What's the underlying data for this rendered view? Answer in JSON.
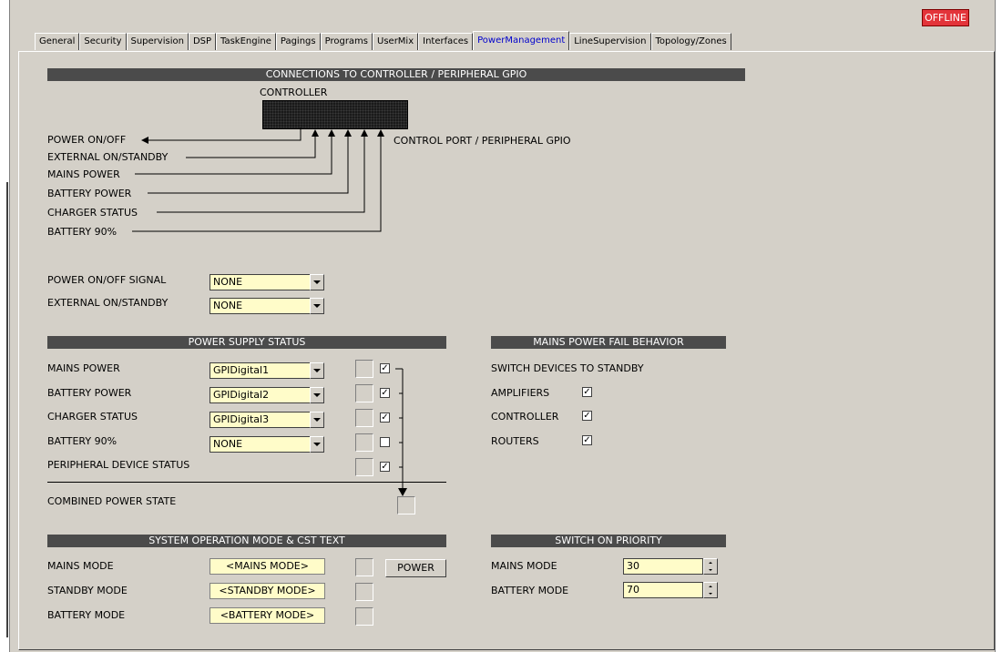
{
  "status": {
    "offline_label": "OFFLINE"
  },
  "tabs": [
    {
      "label": "General"
    },
    {
      "label": "Security"
    },
    {
      "label": "Supervision"
    },
    {
      "label": "DSP"
    },
    {
      "label": "TaskEngine"
    },
    {
      "label": "Pagings"
    },
    {
      "label": "Programs"
    },
    {
      "label": "UserMix"
    },
    {
      "label": "Interfaces"
    },
    {
      "label": "PowerManagement",
      "active": true
    },
    {
      "label": "LineSupervision"
    },
    {
      "label": "Topology/Zones"
    }
  ],
  "connections": {
    "header": "CONNECTIONS TO CONTROLLER / PERIPHERAL GPIO",
    "controller_label": "CONTROLLER",
    "port_label": "CONTROL PORT / PERIPHERAL GPIO",
    "signals": [
      "POWER ON/OFF",
      "EXTERNAL ON/STANDBY",
      "MAINS POWER",
      "BATTERY POWER",
      "CHARGER STATUS",
      "BATTERY 90%"
    ]
  },
  "signals_config": {
    "power_onoff": {
      "label": "POWER ON/OFF SIGNAL",
      "value": "NONE"
    },
    "external_standby": {
      "label": "EXTERNAL ON/STANDBY",
      "value": "NONE"
    }
  },
  "power_supply": {
    "header": "POWER SUPPLY STATUS",
    "rows": [
      {
        "label": "MAINS POWER",
        "value": "GPIDigital1",
        "checked": true
      },
      {
        "label": "BATTERY POWER",
        "value": "GPIDigital2",
        "checked": true
      },
      {
        "label": "CHARGER STATUS",
        "value": "GPIDigital3",
        "checked": true
      },
      {
        "label": "BATTERY 90%",
        "value": "NONE",
        "checked": false
      },
      {
        "label": "PERIPHERAL DEVICE STATUS",
        "value": null,
        "checked": true
      }
    ],
    "combined_label": "COMBINED POWER STATE"
  },
  "mains_fail": {
    "header": "MAINS POWER FAIL BEHAVIOR",
    "subtitle": "SWITCH DEVICES TO STANDBY",
    "items": [
      {
        "label": "AMPLIFIERS",
        "checked": true
      },
      {
        "label": "CONTROLLER",
        "checked": true
      },
      {
        "label": "ROUTERS",
        "checked": true
      }
    ]
  },
  "system_mode": {
    "header": "SYSTEM OPERATION MODE & CST TEXT",
    "rows": [
      {
        "label": "MAINS MODE",
        "value": "<MAINS MODE>"
      },
      {
        "label": "STANDBY MODE",
        "value": "<STANDBY MODE>"
      },
      {
        "label": "BATTERY MODE",
        "value": "<BATTERY MODE>"
      }
    ],
    "power_button": "POWER"
  },
  "switch_priority": {
    "header": "SWITCH ON PRIORITY",
    "rows": [
      {
        "label": "MAINS MODE",
        "value": "30"
      },
      {
        "label": "BATTERY MODE",
        "value": "70"
      }
    ]
  }
}
